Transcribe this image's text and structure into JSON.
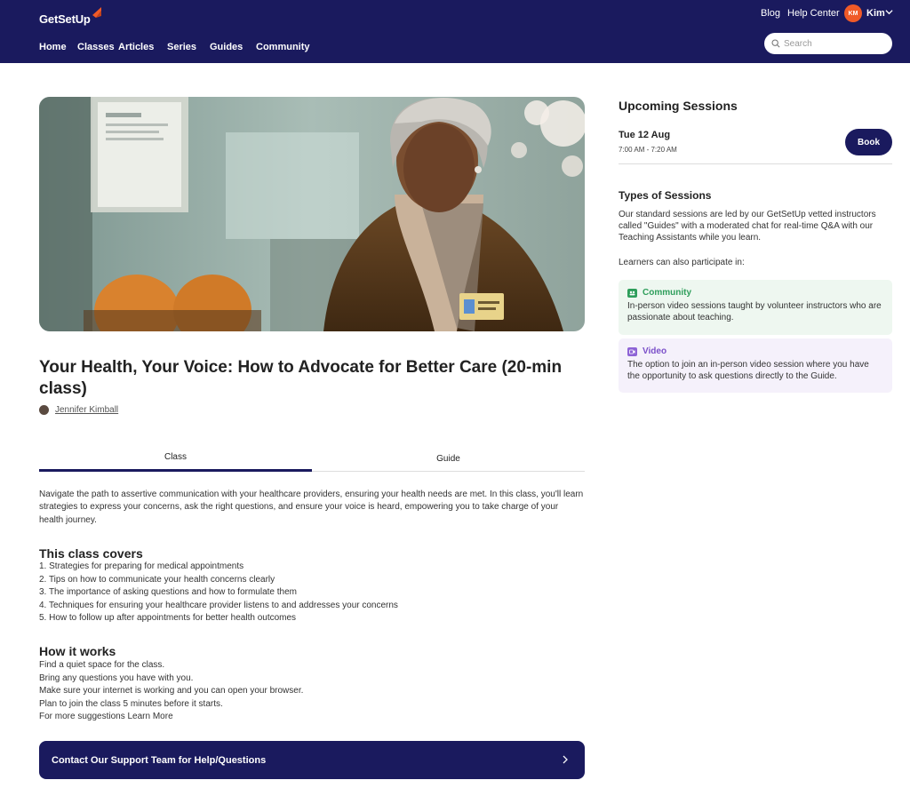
{
  "header": {
    "logo_text": "GetSetUp",
    "nav": [
      "Home",
      "Classes",
      "Articles",
      "Series",
      "Guides",
      "Community"
    ],
    "links": {
      "blog": "Blog",
      "help": "Help Center"
    },
    "user": {
      "initials": "KM",
      "name": "Kim"
    },
    "search_placeholder": "Search"
  },
  "class": {
    "title": "Your Health, Your Voice: How to Advocate for Better Care (20-min class)",
    "guide_name": "Jennifer Kimball",
    "tabs": [
      "Class",
      "Guide"
    ],
    "active_tab": "Class",
    "description": "Navigate the path to assertive communication with your healthcare providers, ensuring your health needs are met. In this class, you'll learn strategies to express your concerns, ask the right questions, and ensure your voice is heard, empowering you to take charge of your health journey.",
    "covers_heading": "This class covers",
    "covers": [
      "1. Strategies for preparing for medical appointments",
      "2. Tips on how to communicate your health concerns clearly",
      "3. The importance of asking questions and how to formulate them",
      "4. Techniques for ensuring your healthcare provider listens to and addresses your concerns",
      "5. How to follow up after appointments for better health outcomes"
    ],
    "how_heading": "How it works",
    "how": [
      "Find a quiet space for the class.",
      "Bring any questions you have with you.",
      "Make sure your internet is working and you can open your browser.",
      "Plan to join the class 5 minutes before it starts.",
      "For more suggestions Learn More"
    ],
    "support_label": "Contact Our Support Team for Help/Questions"
  },
  "sidebar": {
    "upcoming_heading": "Upcoming Sessions",
    "session_date": "Tue 12 Aug",
    "session_time": "7:00 AM - 7:20 AM",
    "book_label": "Book",
    "types_heading": "Types of Sessions",
    "types_text": "Our standard sessions are led by our GetSetUp vetted instructors called \"Guides\" with a moderated chat for real-time Q&A with our Teaching Assistants while you learn.",
    "also_text": "Learners can also participate in:",
    "community_title": "Community",
    "community_text": "In-person video sessions taught by volunteer instructors who are passionate about teaching.",
    "video_title": "Video",
    "video_text": "The option to join an in-person video session where you have the opportunity to ask questions directly to the Guide."
  },
  "colors": {
    "brand_navy": "#1a1a5e",
    "accent_orange": "#f05a28",
    "community_green": "#2e9e5b",
    "video_purple": "#7b4fc9"
  }
}
